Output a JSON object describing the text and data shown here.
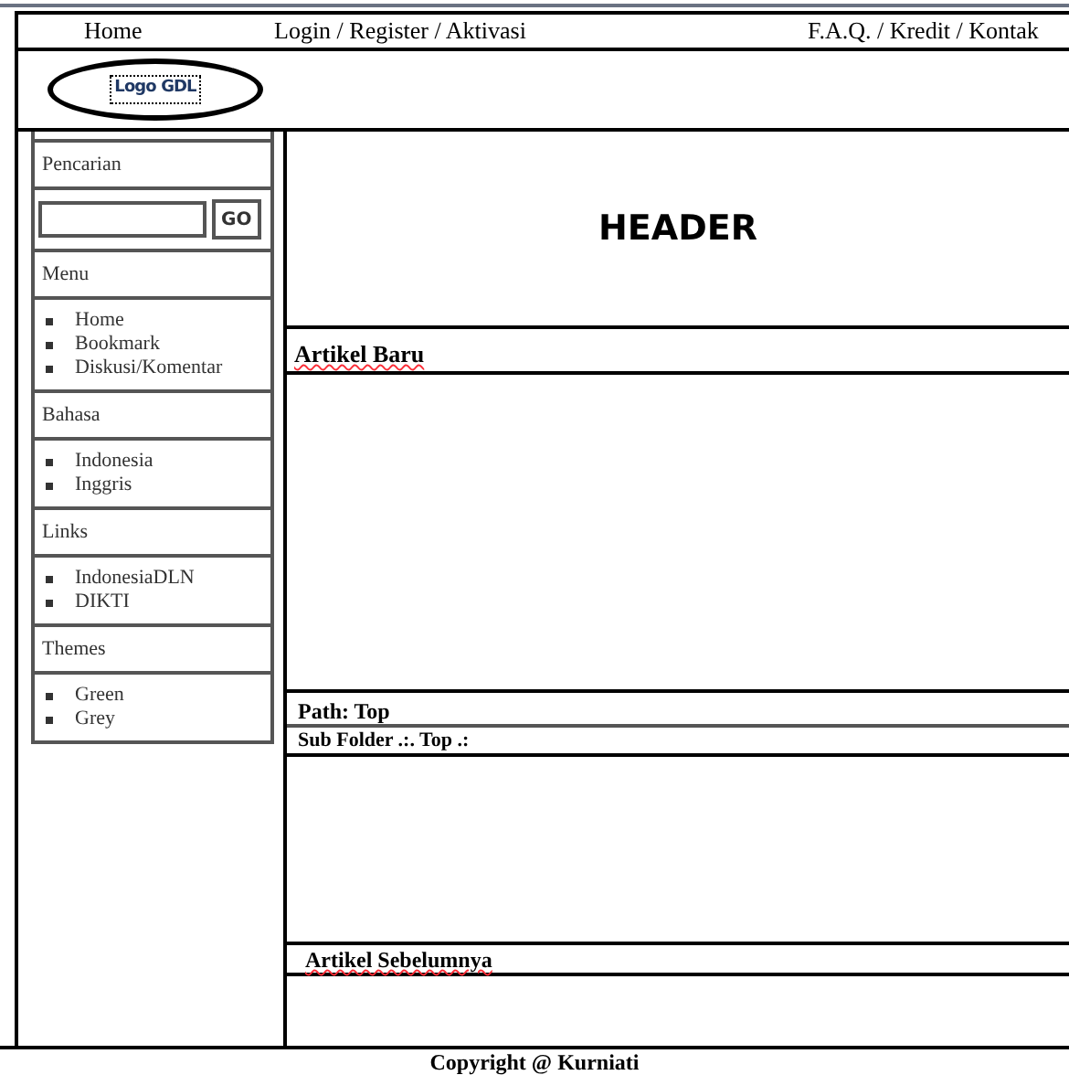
{
  "nav": [
    {
      "label": "Home"
    },
    {
      "label": "Login / Register / Aktivasi"
    },
    {
      "label": "F.A.Q. / Kredit / Kontak"
    }
  ],
  "logo": {
    "label": "Logo GDL"
  },
  "sidebar": [
    {
      "kind": "search",
      "title": "Pencarian",
      "button": "GO"
    },
    {
      "kind": "list",
      "title": "Menu",
      "items": [
        "Home",
        "Bookmark",
        "Diskusi/Komentar"
      ]
    },
    {
      "kind": "list",
      "title": "Bahasa",
      "items": [
        "Indonesia",
        "Inggris"
      ]
    },
    {
      "kind": "list",
      "title": "Links",
      "items": [
        "IndonesiaDLN",
        "DIKTI"
      ]
    },
    {
      "kind": "list",
      "title": "Themes",
      "items": [
        "Green",
        "Grey"
      ]
    }
  ],
  "header": {
    "label": "HEADER"
  },
  "content": {
    "new_articles": "Artikel Baru",
    "path": "Path: Top",
    "sub_folder": "Sub Folder .:. Top .:",
    "previous_articles": "Artikel Sebelumnya"
  },
  "footer": "Copyright @ Kurniati"
}
